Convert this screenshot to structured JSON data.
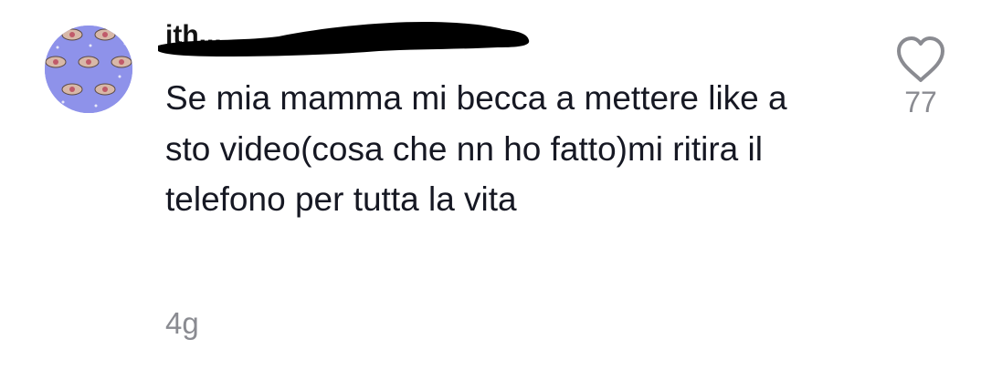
{
  "comment": {
    "username": "ith...",
    "text": "Se mia mamma mi becca a mettere like a sto video(cosa che nn ho fatto)mi ritira il telefono per tutta la vita",
    "timestamp": "4g",
    "likes": "77"
  },
  "icons": {
    "like": "heart-outline-icon",
    "avatar": "user-avatar-image"
  },
  "colors": {
    "text": "#161823",
    "secondary": "#8a8b91",
    "redaction": "#000000",
    "avatar_bg": "#8e92ea"
  }
}
